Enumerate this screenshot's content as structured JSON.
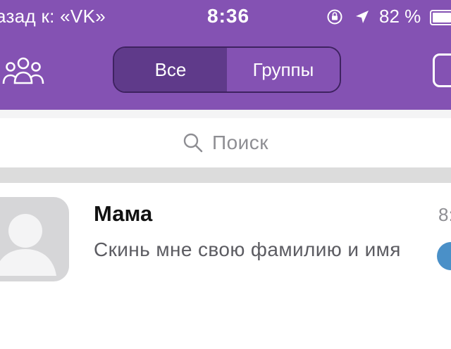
{
  "status_bar": {
    "back_to_app": "азад к: «VK»",
    "time": "8:36",
    "battery_percent": "82 %",
    "battery_level": 0.82,
    "icons": [
      "orientation-lock-icon",
      "location-arrow-icon",
      "battery-icon"
    ]
  },
  "header": {
    "left_icon": "contacts-group-icon",
    "tabs": [
      {
        "label": "Все",
        "active": true
      },
      {
        "label": "Группы",
        "active": false
      }
    ],
    "right_icon": "compose-icon",
    "colors": {
      "header_bg": "#8452b3",
      "active_tab_bg": "#5f3a8a",
      "tab_border": "#3e2260"
    }
  },
  "search": {
    "placeholder": "Поиск",
    "icon": "search-icon"
  },
  "chats": [
    {
      "name": "Мама",
      "preview": "Скинь мне свою фамилию  и имя",
      "time_visible": "8:",
      "avatar": "default-avatar-icon",
      "unread_badge_color": "#4a90c8"
    }
  ]
}
